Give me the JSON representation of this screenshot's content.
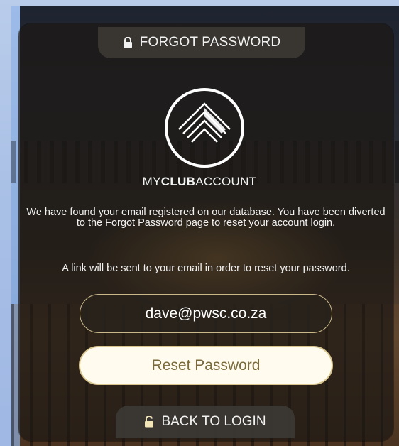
{
  "header": {
    "tab_label": "FORGOT PASSWORD",
    "tab_icon": "lock-icon"
  },
  "brand": {
    "prefix": "MY",
    "bold": "CLUB",
    "suffix": "ACCOUNT"
  },
  "messages": {
    "found": "We have found your email registered on our database. You have been diverted to the Forgot Password page to reset your account login.",
    "link": "A link will be sent to your email in order to reset your password."
  },
  "form": {
    "email_value": "dave@pwsc.co.za",
    "reset_label": "Reset Password"
  },
  "footer": {
    "back_label": "BACK TO LOGIN",
    "back_icon": "unlock-icon"
  },
  "colors": {
    "panel": "#1c1814",
    "accent_gold": "#d8c58d",
    "button_text": "#7a6a3c",
    "page_bg": "#a9c0e6"
  }
}
